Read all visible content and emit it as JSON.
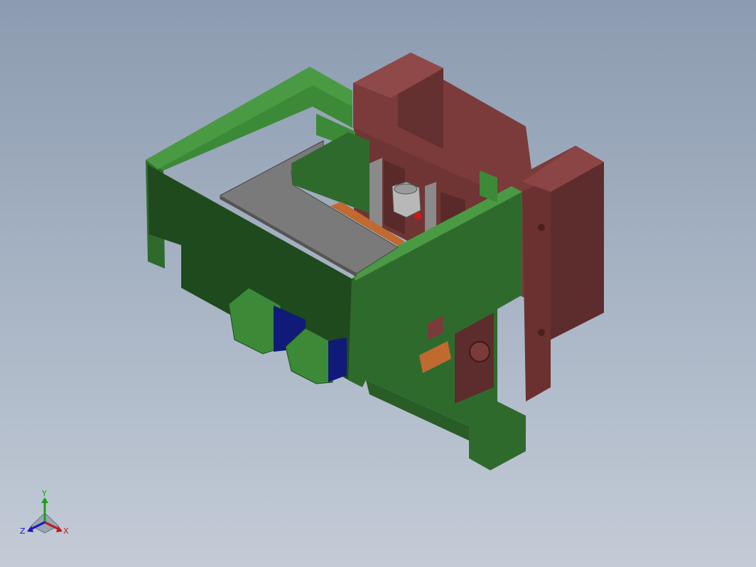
{
  "viewport": {
    "background_top": "#8c9bb0",
    "background_bottom": "#c3cbd6"
  },
  "colors": {
    "frame_green": "#2f6a2d",
    "frame_green_light": "#3c8a38",
    "frame_green_dark": "#1e4a1d",
    "column_red": "#7a3b3a",
    "column_red_light": "#8c4645",
    "column_red_dark": "#5a2a2a",
    "table_gray": "#7a7a7a",
    "motor_blue": "#101a78",
    "copper": "#c06a30"
  },
  "triad": {
    "y_label": "Y",
    "x_label": "X",
    "z_label": "Z",
    "y_color": "#1aa01a",
    "x_color": "#c01818",
    "z_color": "#1818c0"
  }
}
